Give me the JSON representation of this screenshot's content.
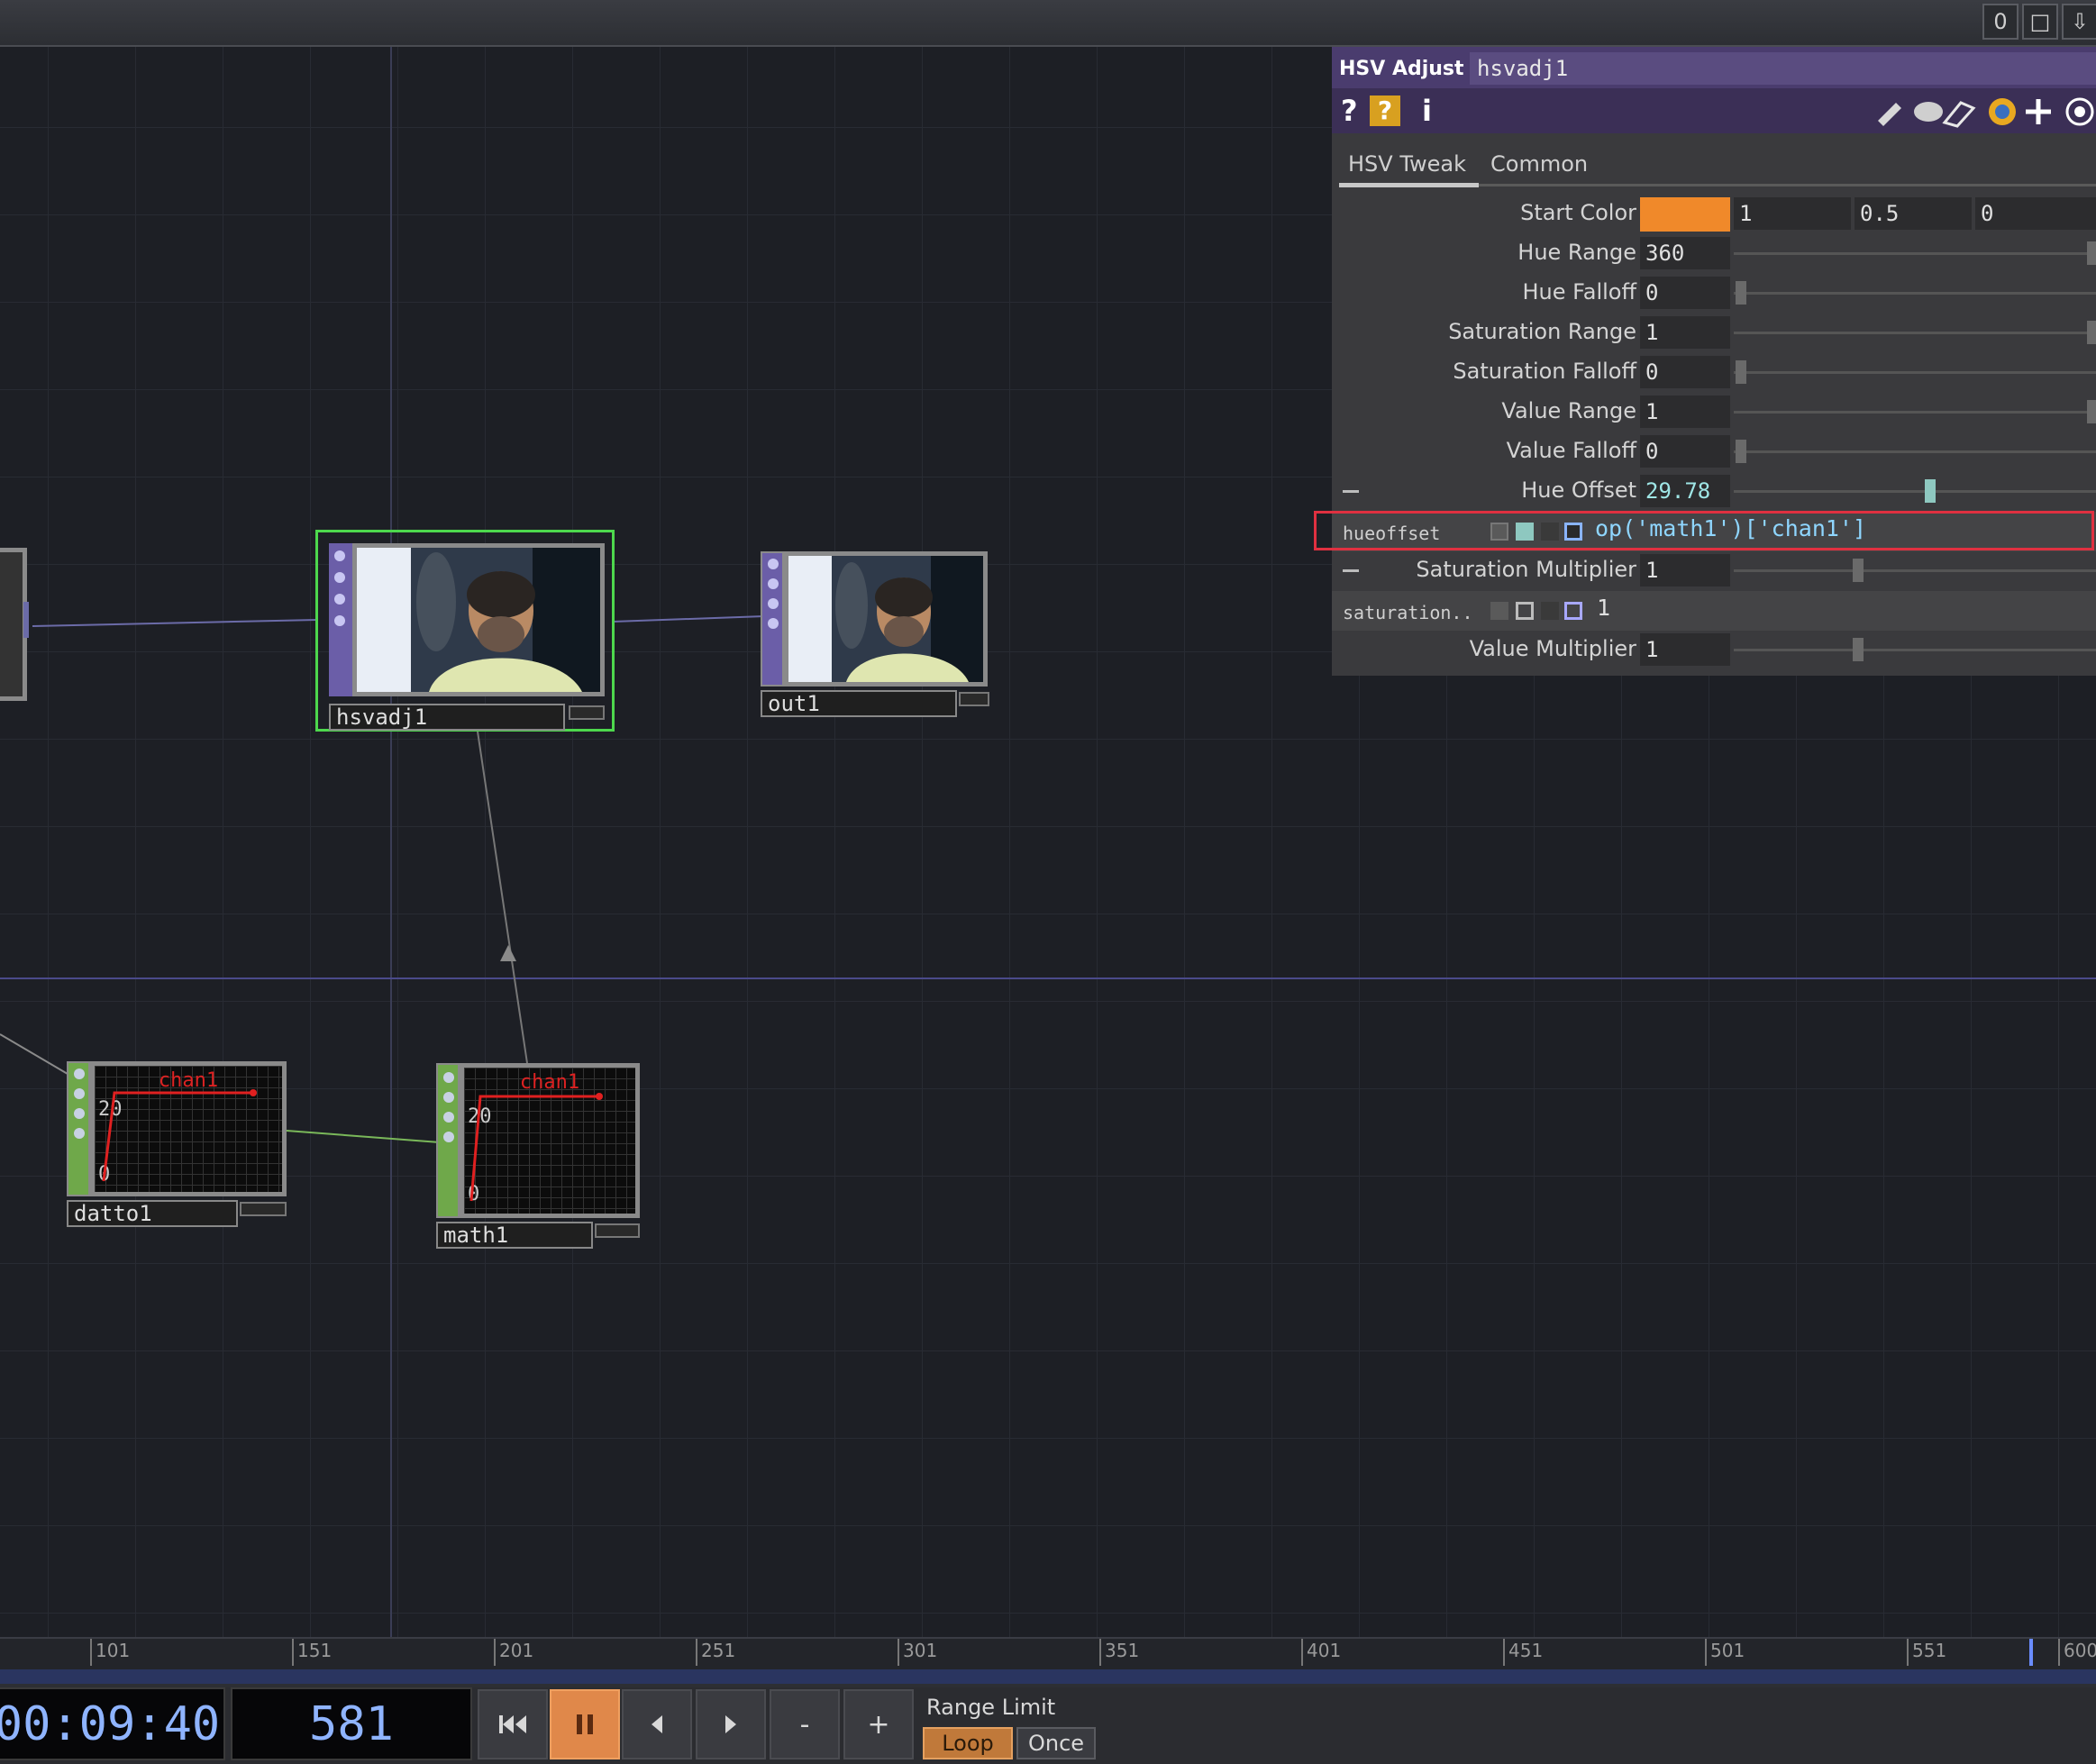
{
  "topbar": {
    "buttons": [
      "0",
      "□",
      "⇩"
    ]
  },
  "nodes": {
    "hsvadj1": {
      "label": "hsvadj1"
    },
    "out1": {
      "label": "out1"
    },
    "datto1": {
      "label": "datto1",
      "chart_title": "chan1",
      "tick_top": "20",
      "tick_bottom": "0"
    },
    "math1": {
      "label": "math1",
      "chart_title": "chan1",
      "tick_top": "20",
      "tick_bottom": "0"
    }
  },
  "panel": {
    "op_type": "HSV Adjust",
    "op_name": "hsvadj1",
    "icons": [
      "?",
      "?",
      "i"
    ],
    "tabs": [
      {
        "label": "HSV Tweak",
        "active": true
      },
      {
        "label": "Common",
        "active": false
      }
    ],
    "start_color": {
      "label": "Start Color",
      "swatch": "#f0892a",
      "r": "1",
      "g": "0.5",
      "b": "0"
    },
    "params": [
      {
        "label": "Hue Range",
        "value": "360"
      },
      {
        "label": "Hue Falloff",
        "value": "0"
      },
      {
        "label": "Saturation Range",
        "value": "1"
      },
      {
        "label": "Saturation Falloff",
        "value": "0"
      },
      {
        "label": "Value Range",
        "value": "1"
      },
      {
        "label": "Value Falloff",
        "value": "0"
      },
      {
        "label": "Hue Offset",
        "value": "29.78"
      }
    ],
    "hue_expr": {
      "name": "hueoffset",
      "expression": "op('math1')['chan1']"
    },
    "sat_mult": {
      "label": "Saturation Multiplier",
      "value": "1"
    },
    "sat_expr": {
      "name": "saturation..",
      "value": "1"
    },
    "val_mult": {
      "label": "Value Multiplier",
      "value": "1"
    }
  },
  "timeline": {
    "ticks": [
      "101",
      "151",
      "201",
      "251",
      "301",
      "351",
      "401",
      "451",
      "501",
      "551",
      "600"
    ],
    "timecode": "00:09:40",
    "frame": "581",
    "range_limit_label": "Range Limit",
    "loop_label": "Loop",
    "once_label": "Once",
    "minus": "-",
    "plus": "+"
  }
}
